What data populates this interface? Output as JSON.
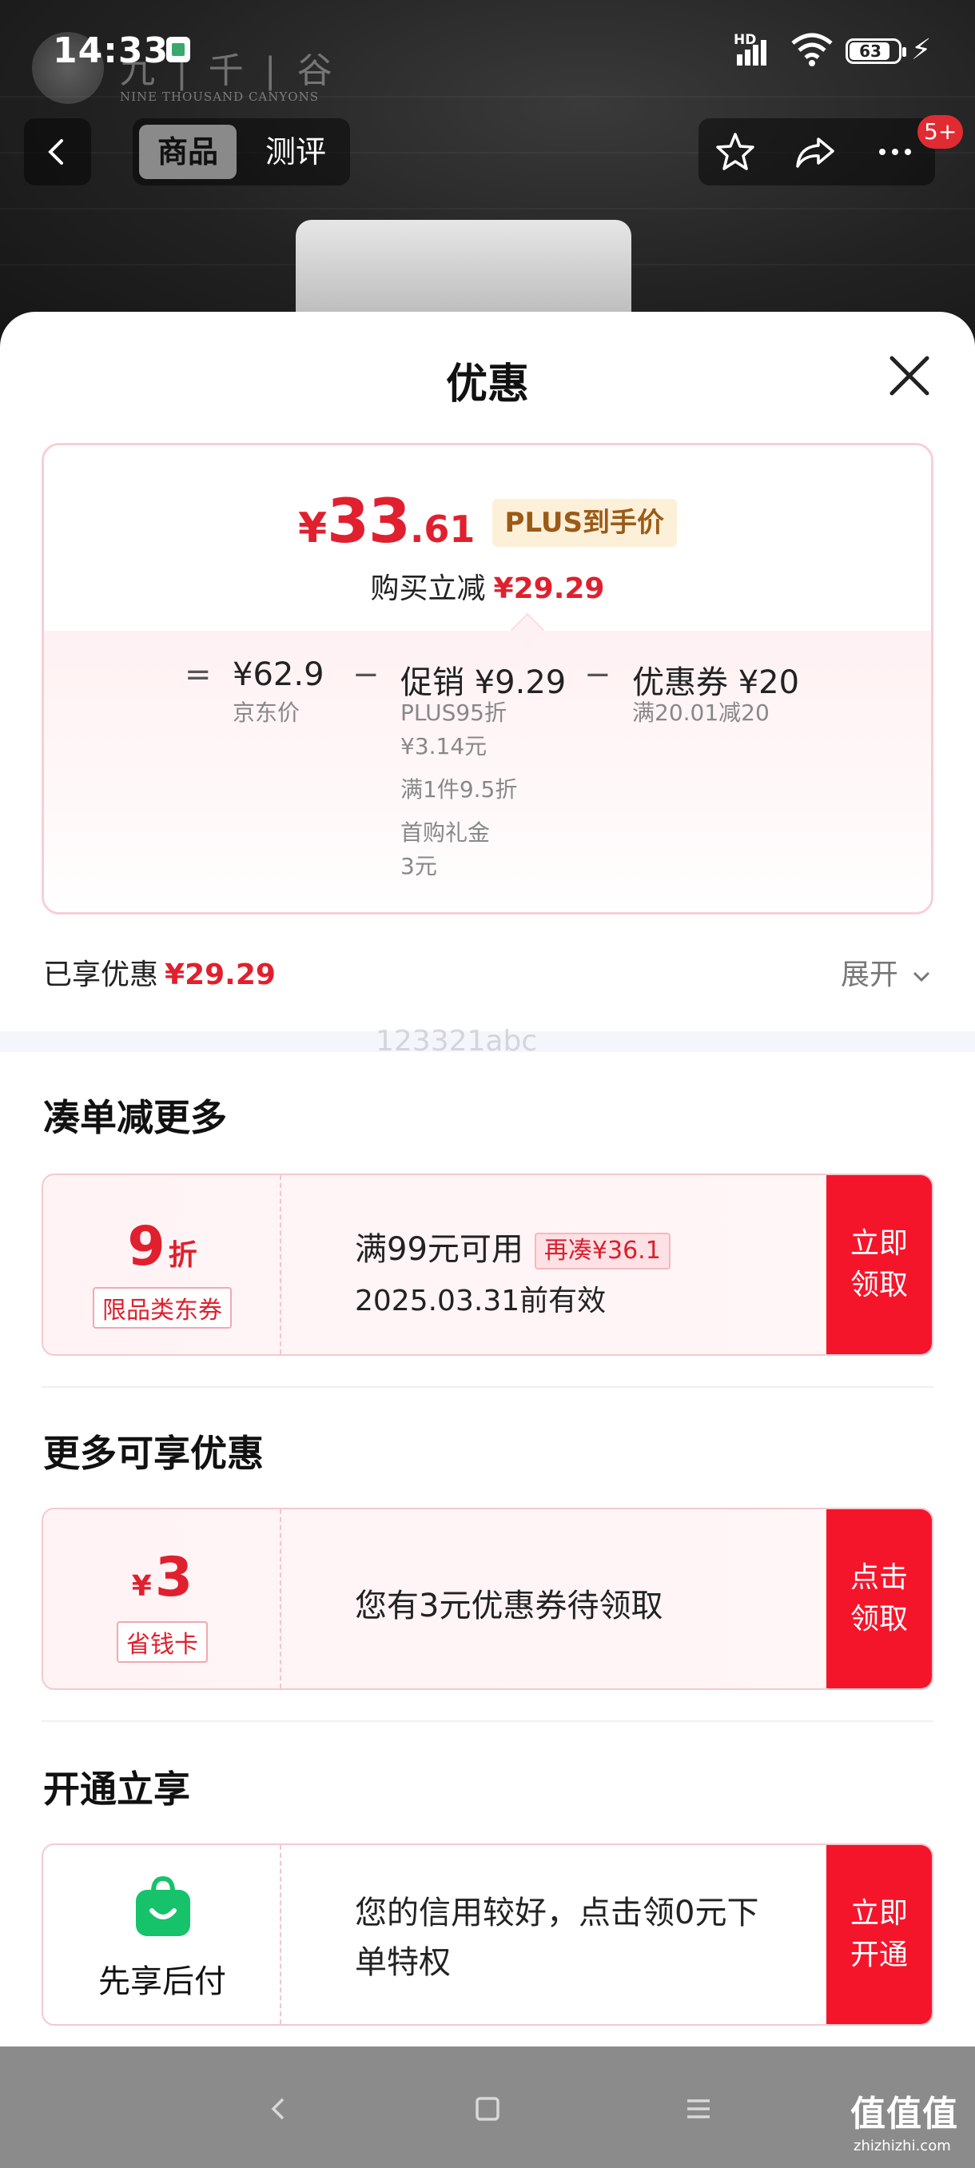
{
  "status_bar": {
    "time": "14:33",
    "network": "HD",
    "battery": "63"
  },
  "brand": {
    "name": "九 | 千 | 谷",
    "subtitle": "NINE THOUSAND CANYONS"
  },
  "nav": {
    "tabs": [
      {
        "label": "商品",
        "active": true
      },
      {
        "label": "测评",
        "active": false
      }
    ],
    "badge": "5+",
    "icons": [
      "back-icon",
      "star-icon",
      "share-icon",
      "more-icon"
    ]
  },
  "sheet": {
    "title": "优惠",
    "price": {
      "currency": "¥",
      "integer": "33",
      "decimal": ".61",
      "tag": "PLUS到手价",
      "reduce_label": "购买立减",
      "reduce_amount": "¥29.29"
    },
    "calc": {
      "equals": "=",
      "minus": "−",
      "jd_price": "¥62.9",
      "jd_price_label": "京东价",
      "promo": "促销 ¥9.29",
      "promo_items": [
        "PLUS95折",
        "¥3.14元",
        "满1件9.5折",
        "首购礼金",
        "3元"
      ],
      "coupon": "优惠券 ¥20",
      "coupon_rule": "满20.01减20"
    },
    "enjoyed_label": "已享优惠",
    "enjoyed_amount": "¥29.29",
    "expand_label": "展开",
    "watermark": "123321abc",
    "sections": {
      "combine": {
        "title": "凑单减更多",
        "discount_value": "9",
        "discount_unit": "折",
        "scope": "限品类东券",
        "condition": "满99元可用",
        "add_more": "再凑¥36.1",
        "expiry": "2025.03.31前有效",
        "button": "立即\n领取"
      },
      "more": {
        "title": "更多可享优惠",
        "currency": "¥",
        "value": "3",
        "card_label": "省钱卡",
        "desc": "您有3元优惠券待领取",
        "button": "点击\n领取"
      },
      "open": {
        "title": "开通立享",
        "service": "先享后付",
        "desc_line1": "您的信用较好，点击领0元下",
        "desc_line2": "单特权",
        "button": "立即\n开通"
      }
    }
  },
  "footer_brand": {
    "name": "值值值",
    "url": "zhizhizhi.com"
  },
  "colors": {
    "accent_red": "#e0202e",
    "button_red": "#f5152b",
    "plus_gold": "#9b5a17"
  }
}
